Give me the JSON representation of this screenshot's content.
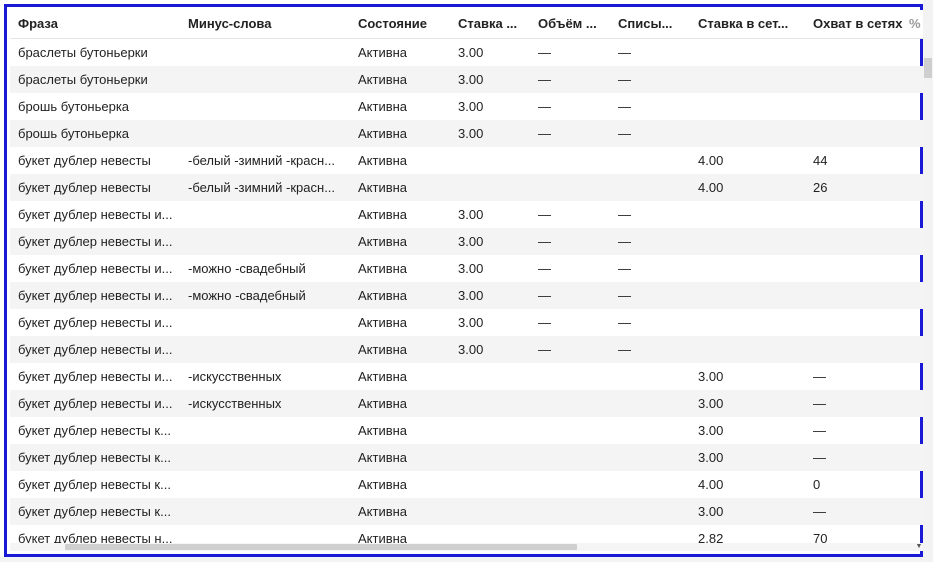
{
  "columns": {
    "phrase": "Фраза",
    "minus_words": "Минус-слова",
    "state": "Состояние",
    "bid": "Ставка ...",
    "volume": "Объём ...",
    "charge": "Списы...",
    "network_bid": "Ставка в сет...",
    "network_reach": "Охват в сетях",
    "percent": "%"
  },
  "rows": [
    {
      "phrase": "браслеты бутоньерки",
      "minus": "",
      "state": "Активна",
      "bid": "3.00",
      "volume": "—",
      "charge": "—",
      "nbid": "",
      "reach": ""
    },
    {
      "phrase": "браслеты бутоньерки",
      "minus": "",
      "state": "Активна",
      "bid": "3.00",
      "volume": "—",
      "charge": "—",
      "nbid": "",
      "reach": ""
    },
    {
      "phrase": "брошь бутоньерка",
      "minus": "",
      "state": "Активна",
      "bid": "3.00",
      "volume": "—",
      "charge": "—",
      "nbid": "",
      "reach": ""
    },
    {
      "phrase": "брошь бутоньерка",
      "minus": "",
      "state": "Активна",
      "bid": "3.00",
      "volume": "—",
      "charge": "—",
      "nbid": "",
      "reach": ""
    },
    {
      "phrase": "букет дублер невесты",
      "minus": "-белый -зимний -красн...",
      "state": "Активна",
      "bid": "",
      "volume": "",
      "charge": "",
      "nbid": "4.00",
      "reach": "44"
    },
    {
      "phrase": "букет дублер невесты",
      "minus": "-белый -зимний -красн...",
      "state": "Активна",
      "bid": "",
      "volume": "",
      "charge": "",
      "nbid": "4.00",
      "reach": "26"
    },
    {
      "phrase": "букет дублер невесты и...",
      "minus": "",
      "state": "Активна",
      "bid": "3.00",
      "volume": "—",
      "charge": "—",
      "nbid": "",
      "reach": ""
    },
    {
      "phrase": "букет дублер невесты и...",
      "minus": "",
      "state": "Активна",
      "bid": "3.00",
      "volume": "—",
      "charge": "—",
      "nbid": "",
      "reach": ""
    },
    {
      "phrase": "букет дублер невесты и...",
      "minus": "-можно -свадебный",
      "state": "Активна",
      "bid": "3.00",
      "volume": "—",
      "charge": "—",
      "nbid": "",
      "reach": ""
    },
    {
      "phrase": "букет дублер невесты и...",
      "minus": "-можно -свадебный",
      "state": "Активна",
      "bid": "3.00",
      "volume": "—",
      "charge": "—",
      "nbid": "",
      "reach": ""
    },
    {
      "phrase": "букет дублер невесты и...",
      "minus": "",
      "state": "Активна",
      "bid": "3.00",
      "volume": "—",
      "charge": "—",
      "nbid": "",
      "reach": ""
    },
    {
      "phrase": "букет дублер невесты и...",
      "minus": "",
      "state": "Активна",
      "bid": "3.00",
      "volume": "—",
      "charge": "—",
      "nbid": "",
      "reach": ""
    },
    {
      "phrase": "букет дублер невесты и...",
      "minus": "-искусственных",
      "state": "Активна",
      "bid": "",
      "volume": "",
      "charge": "",
      "nbid": "3.00",
      "reach": "—"
    },
    {
      "phrase": "букет дублер невесты и...",
      "minus": "-искусственных",
      "state": "Активна",
      "bid": "",
      "volume": "",
      "charge": "",
      "nbid": "3.00",
      "reach": "—"
    },
    {
      "phrase": "букет дублер невесты к...",
      "minus": "",
      "state": "Активна",
      "bid": "",
      "volume": "",
      "charge": "",
      "nbid": "3.00",
      "reach": "—"
    },
    {
      "phrase": "букет дублер невесты к...",
      "minus": "",
      "state": "Активна",
      "bid": "",
      "volume": "",
      "charge": "",
      "nbid": "3.00",
      "reach": "—"
    },
    {
      "phrase": "букет дублер невесты к...",
      "minus": "",
      "state": "Активна",
      "bid": "",
      "volume": "",
      "charge": "",
      "nbid": "4.00",
      "reach": "0"
    },
    {
      "phrase": "букет дублер невесты к...",
      "minus": "",
      "state": "Активна",
      "bid": "",
      "volume": "",
      "charge": "",
      "nbid": "3.00",
      "reach": "—"
    },
    {
      "phrase": "букет дублер невесты н...",
      "minus": "",
      "state": "Активна",
      "bid": "",
      "volume": "",
      "charge": "",
      "nbid": "2.82",
      "reach": "70"
    }
  ]
}
